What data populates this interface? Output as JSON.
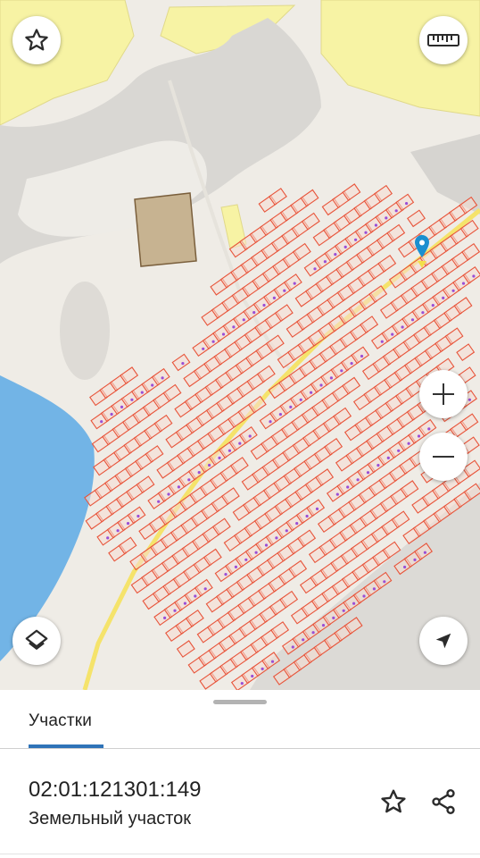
{
  "map": {
    "colors": {
      "water": "#72b4e6",
      "forest": "#f7f3a4",
      "parcel_outline": "#e8543a",
      "parcel_fill": "#f6dcd2",
      "road": "#f5e36b",
      "building": "#c7b391",
      "marker": "#1b8fd0"
    },
    "controls": {
      "favorite": "star-icon",
      "ruler": "ruler-icon",
      "zoom_in": "plus-icon",
      "zoom_out": "minus-icon",
      "layers": "layers-icon",
      "locate": "navigation-arrow-icon"
    }
  },
  "sheet": {
    "tab_label": "Участки",
    "parcel": {
      "cadastral_number": "02:01:121301:149",
      "type": "Земельный участок"
    }
  }
}
